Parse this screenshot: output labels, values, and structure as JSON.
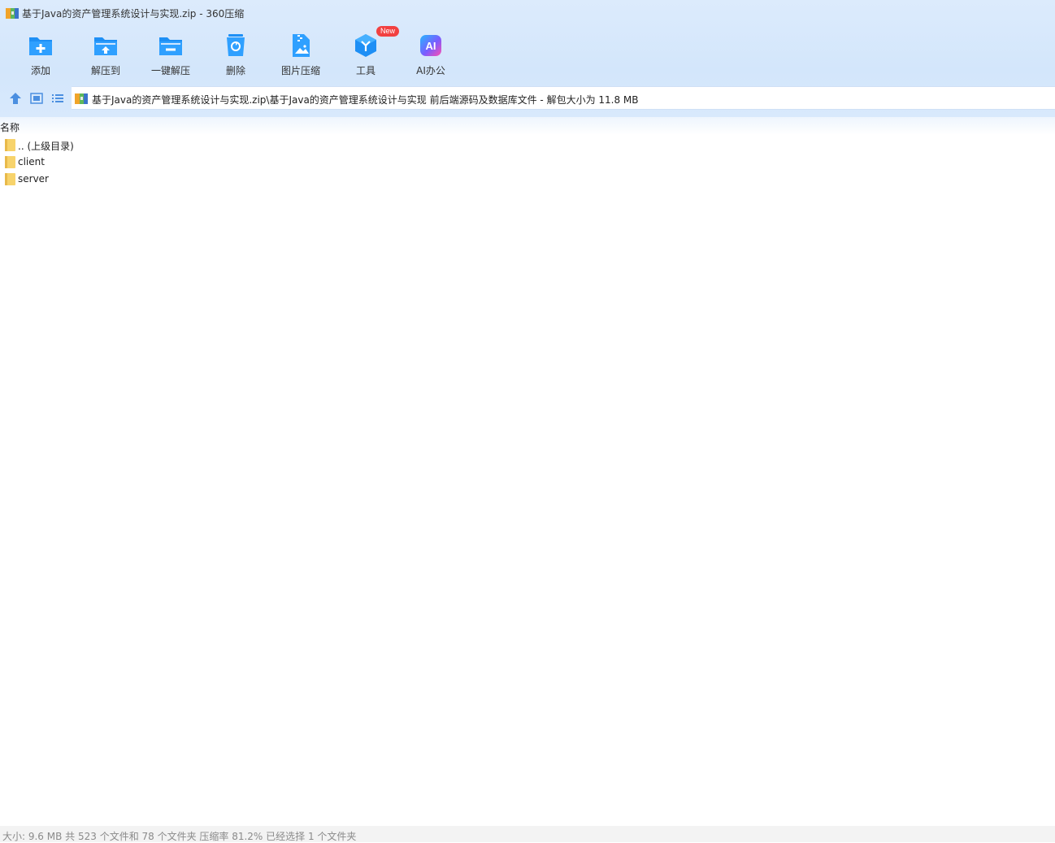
{
  "window": {
    "title": "基于Java的资产管理系统设计与实现.zip - 360压缩"
  },
  "toolbar": {
    "items": [
      {
        "label": "添加",
        "icon": "add-folder-icon"
      },
      {
        "label": "解压到",
        "icon": "extract-to-icon"
      },
      {
        "label": "一键解压",
        "icon": "one-click-extract-icon"
      },
      {
        "label": "删除",
        "icon": "delete-icon"
      },
      {
        "label": "图片压缩",
        "icon": "image-compress-icon"
      },
      {
        "label": "工具",
        "icon": "tools-icon",
        "badge": "New"
      },
      {
        "label": "AI办公",
        "icon": "ai-office-icon",
        "icon_text": "AI"
      }
    ]
  },
  "address": {
    "path": "基于Java的资产管理系统设计与实现.zip\\基于Java的资产管理系统设计与实现 前后端源码及数据库文件 - 解包大小为 11.8 MB"
  },
  "filelist": {
    "column_name": "名称",
    "rows": [
      {
        "name": ".. (上级目录)"
      },
      {
        "name": "client"
      },
      {
        "name": "server"
      }
    ]
  },
  "status": {
    "text": "大小: 9.6 MB 共 523 个文件和 78 个文件夹 压缩率 81.2% 已经选择 1 个文件夹"
  },
  "colors": {
    "accent": "#1e90f5",
    "badge": "#f24141",
    "folder": "#f7d36b"
  }
}
